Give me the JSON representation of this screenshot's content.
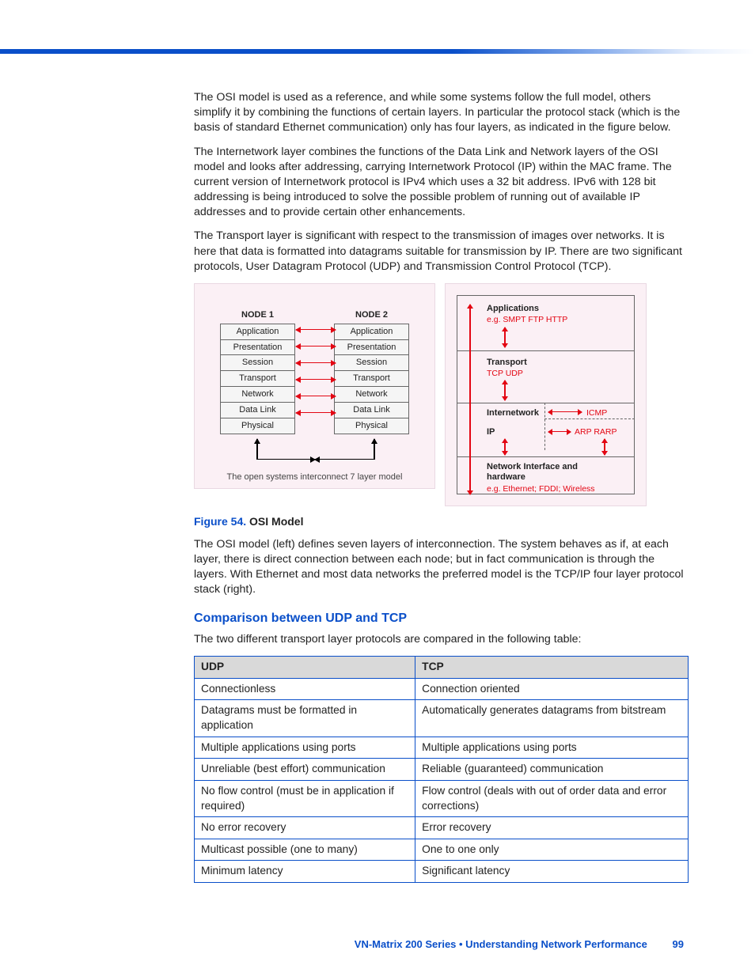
{
  "paragraphs": {
    "p1": "The OSI model is used as a reference, and while some systems follow the full model, others simplify it by combining the functions of certain layers. In particular the protocol stack (which is the basis of standard Ethernet communication) only has four layers, as indicated in the figure below.",
    "p2": "The Internetwork layer combines the functions of the Data Link and Network layers of the OSI model and looks after addressing, carrying Internetwork Protocol (IP) within the MAC frame. The current version of Internetwork protocol is IPv4 which uses a 32 bit address. IPv6 with 128 bit addressing is being introduced to solve the possible problem of running out of available IP addresses and to provide certain other enhancements.",
    "p3": "The Transport layer is significant with respect to the transmission of images over networks. It is here that data is formatted into datagrams suitable for transmission by IP. There are two significant protocols, User Datagram Protocol (UDP) and Transmission Control Protocol (TCP).",
    "p4": "The OSI model (left) defines seven layers of interconnection. The system behaves as if, at each layer, there is direct connection between each node; but in fact communication is through the layers. With Ethernet and most data networks the preferred model is the TCP/IP four layer protocol stack (right).",
    "p5": "The two different transport layer protocols are compared in the following table:"
  },
  "figure": {
    "number": "Figure 54.",
    "title": "OSI Model",
    "left": {
      "node1": "NODE 1",
      "node2": "NODE 2",
      "layers": [
        "Application",
        "Presentation",
        "Session",
        "Transport",
        "Network",
        "Data Link",
        "Physical"
      ],
      "caption": "The open systems interconnect 7 layer model"
    },
    "right": {
      "app": "Applications",
      "app_eg": "e.g. SMPT FTP HTTP",
      "transport": "Transport",
      "transport_eg": "TCP UDP",
      "inet": "Internetwork",
      "icmp": "ICMP",
      "ip": "IP",
      "arp": "ARP RARP",
      "netif": "Network Interface and hardware",
      "netif_eg": "e.g. Ethernet; FDDI; Wireless"
    }
  },
  "subhead": "Comparison between UDP and TCP",
  "table": {
    "headers": {
      "udp": "UDP",
      "tcp": "TCP"
    },
    "rows": [
      {
        "udp": "Connectionless",
        "tcp": "Connection oriented"
      },
      {
        "udp": "Datagrams must be formatted in application",
        "tcp": "Automatically generates datagrams from bitstream"
      },
      {
        "udp": "Multiple applications using ports",
        "tcp": "Multiple applications using ports"
      },
      {
        "udp": "Unreliable (best effort) communication",
        "tcp": "Reliable (guaranteed) communication"
      },
      {
        "udp": "No flow control (must be in application if required)",
        "tcp": "Flow control (deals with out of order data and error corrections)"
      },
      {
        "udp": "No error recovery",
        "tcp": "Error recovery"
      },
      {
        "udp": "Multicast possible (one to many)",
        "tcp": "One to one only"
      },
      {
        "udp": "Minimum latency",
        "tcp": "Significant latency"
      }
    ]
  },
  "footer": {
    "text": "VN-Matrix 200 Series  •  Understanding Network Performance",
    "page": "99"
  }
}
